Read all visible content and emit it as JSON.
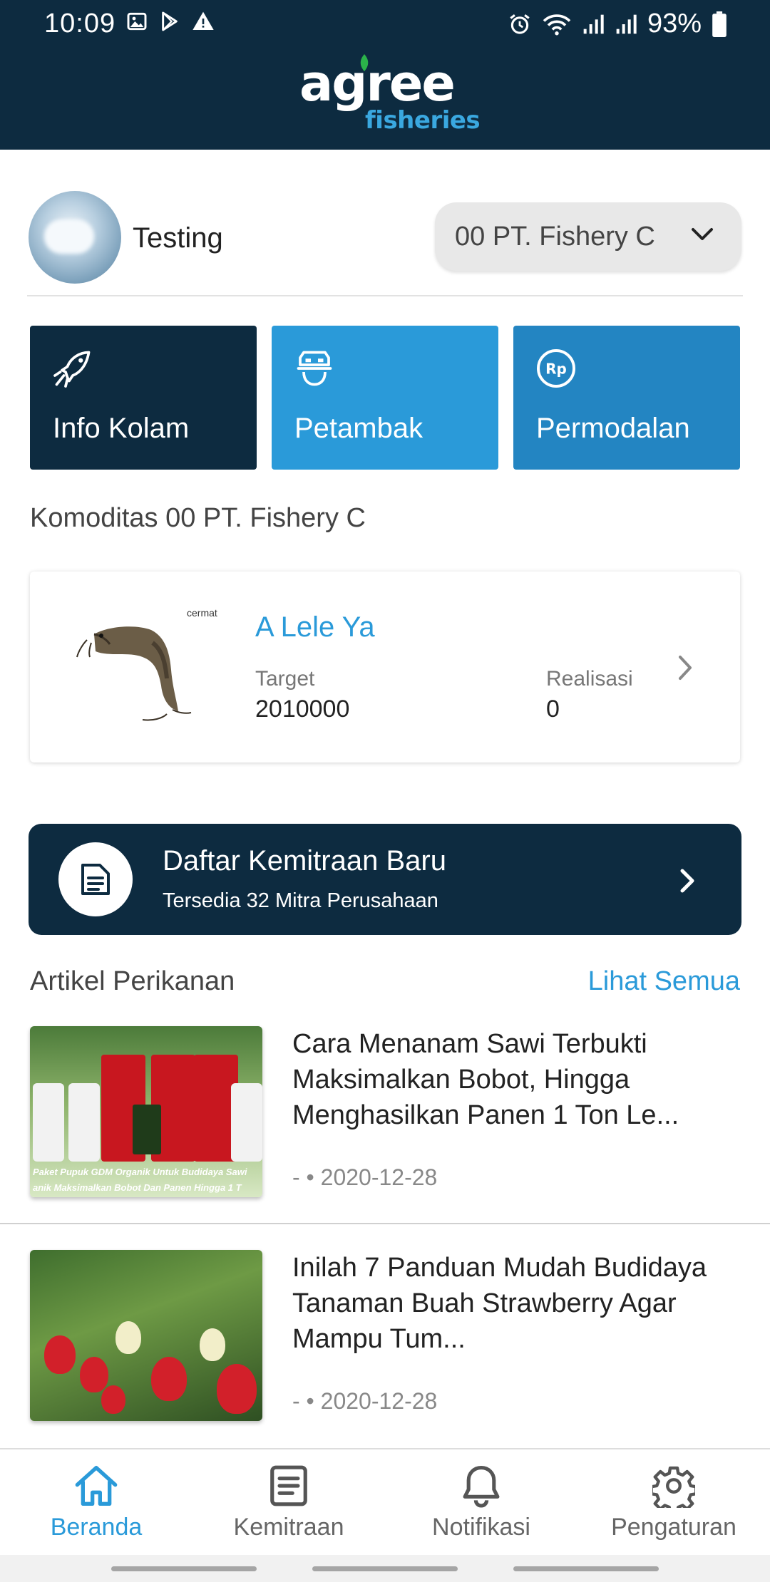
{
  "status_bar": {
    "time": "10:09",
    "battery": "93%",
    "left_icons": [
      "image-icon",
      "play-store-icon",
      "warning-icon"
    ],
    "right_icons": [
      "alarm-icon",
      "wifi-icon",
      "signal-icon",
      "signal-icon",
      "battery-icon"
    ]
  },
  "header": {
    "logo_main": "agree",
    "logo_sub": "fisheries"
  },
  "profile": {
    "name": "Testing",
    "company_selected": "00 PT. Fishery C"
  },
  "tiles": [
    {
      "label": "Info Kolam",
      "icon": "fish-icon",
      "color": "#0d2b40"
    },
    {
      "label": "Petambak",
      "icon": "farmer-icon",
      "color": "#2a9ad9"
    },
    {
      "label": "Permodalan",
      "icon": "rupiah-icon",
      "color": "#2385c2"
    }
  ],
  "komoditas": {
    "title": "Komoditas 00 PT. Fishery C",
    "item": {
      "badge": "cermat",
      "name": "A Lele Ya",
      "target_label": "Target",
      "target_value": "2010000",
      "realisasi_label": "Realisasi",
      "realisasi_value": "0"
    }
  },
  "partner_banner": {
    "title": "Daftar Kemitraan Baru",
    "subtitle": "Tersedia 32 Mitra Perusahaan"
  },
  "articles_section": {
    "title": "Artikel Perikanan",
    "see_all": "Lihat Semua",
    "items": [
      {
        "title": "Cara Menanam Sawi Terbukti Maksimalkan Bobot, Hingga Menghasilkan Panen 1 Ton Le...",
        "meta": "- • 2020-12-28",
        "thumb_caption_1": "Paket Pupuk GDM Organik Untuk Budidaya Sawi",
        "thumb_caption_2": "anik Maksimalkan Bobot Dan Panen Hingga 1 T"
      },
      {
        "title": "Inilah 7 Panduan Mudah Budidaya Tanaman Buah Strawberry Agar Mampu Tum...",
        "meta": "- • 2020-12-28"
      }
    ]
  },
  "bottom_nav": [
    {
      "label": "Beranda",
      "icon": "home-icon",
      "active": true
    },
    {
      "label": "Kemitraan",
      "icon": "document-icon",
      "active": false
    },
    {
      "label": "Notifikasi",
      "icon": "bell-icon",
      "active": false
    },
    {
      "label": "Pengaturan",
      "icon": "gear-icon",
      "active": false
    }
  ],
  "colors": {
    "primary_dark": "#0d2b40",
    "accent": "#2a9ad9"
  }
}
